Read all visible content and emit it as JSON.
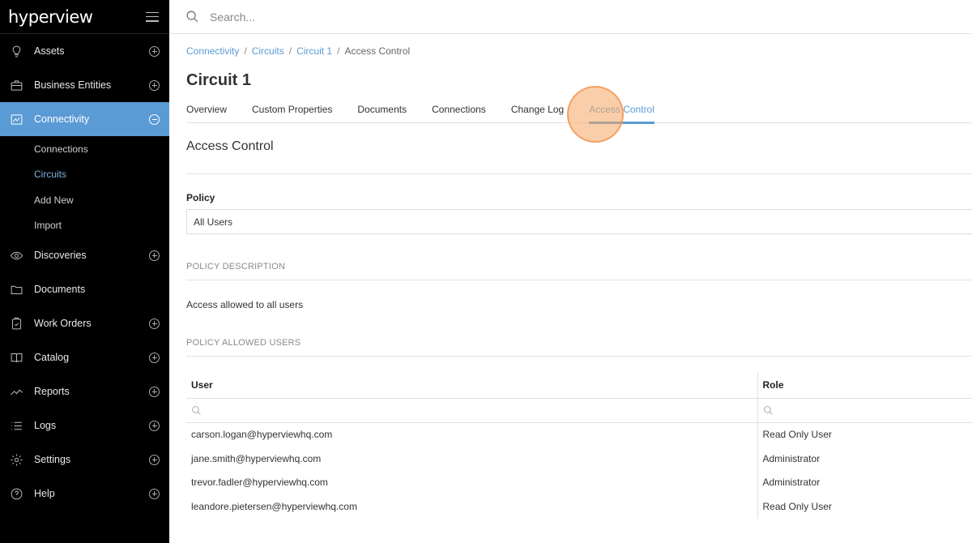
{
  "brand": {
    "logo_text": "hyperview"
  },
  "search": {
    "placeholder": "Search..."
  },
  "sidebar": {
    "items": [
      {
        "label": "Assets",
        "icon": "lightbulb-icon"
      },
      {
        "label": "Business Entities",
        "icon": "briefcase-icon"
      },
      {
        "label": "Connectivity",
        "icon": "network-icon",
        "active": true,
        "submenu": [
          "Connections",
          "Circuits",
          "Add New",
          "Import"
        ],
        "current_sub": "Circuits"
      },
      {
        "label": "Discoveries",
        "icon": "eye-icon"
      },
      {
        "label": "Documents",
        "icon": "folder-icon"
      },
      {
        "label": "Work Orders",
        "icon": "clipboard-check-icon"
      },
      {
        "label": "Catalog",
        "icon": "book-icon"
      },
      {
        "label": "Reports",
        "icon": "trend-line-icon"
      },
      {
        "label": "Logs",
        "icon": "list-icon"
      },
      {
        "label": "Settings",
        "icon": "gear-icon"
      },
      {
        "label": "Help",
        "icon": "question-circle-icon"
      }
    ]
  },
  "breadcrumb": {
    "items": [
      "Connectivity",
      "Circuits",
      "Circuit 1"
    ],
    "current": "Access Control"
  },
  "page": {
    "title": "Circuit 1"
  },
  "tabs": [
    {
      "label": "Overview"
    },
    {
      "label": "Custom Properties"
    },
    {
      "label": "Documents"
    },
    {
      "label": "Connections"
    },
    {
      "label": "Change Log"
    },
    {
      "label": "Access Control",
      "active": true
    }
  ],
  "access_control": {
    "title": "Access Control",
    "policy_label": "Policy",
    "policy_value": "All Users",
    "policy_description_heading": "POLICY DESCRIPTION",
    "policy_description": "Access allowed to all users",
    "policy_allowed_users_heading": "POLICY ALLOWED USERS",
    "table": {
      "columns": [
        "User",
        "Role"
      ],
      "rows": [
        [
          "carson.logan@hyperviewhq.com",
          "Read Only User"
        ],
        [
          "jane.smith@hyperviewhq.com",
          "Administrator"
        ],
        [
          "trevor.fadler@hyperviewhq.com",
          "Administrator"
        ],
        [
          "leandore.pietersen@hyperviewhq.com",
          "Read Only User"
        ]
      ]
    }
  },
  "colors": {
    "accent": "#5b9bd5",
    "sidebar_bg": "#000000",
    "click_marker": "#f5a662"
  }
}
